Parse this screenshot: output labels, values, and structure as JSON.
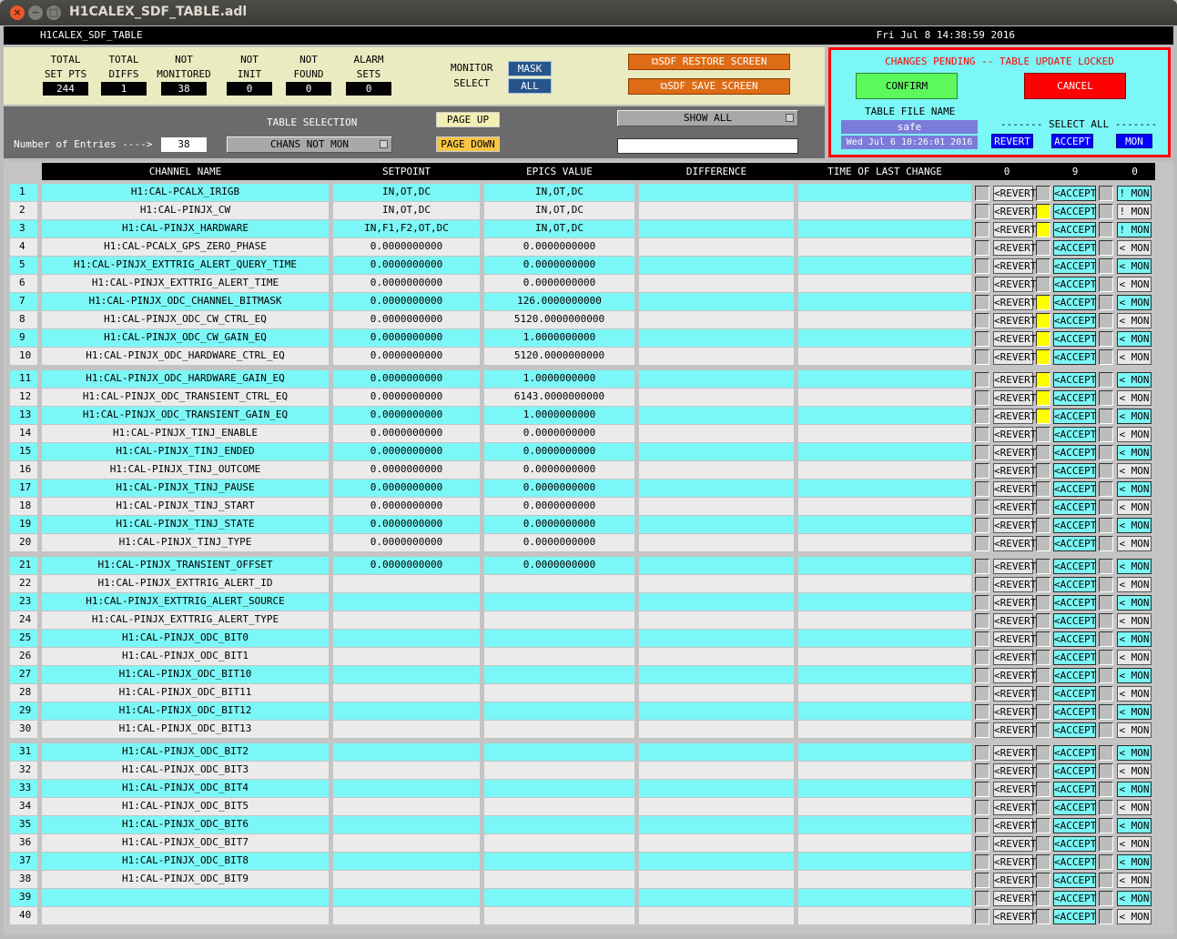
{
  "window": {
    "title": "H1CALEX_SDF_TABLE.adl"
  },
  "topbar": {
    "screen_name": "H1CALEX_SDF_TABLE",
    "datetime": "Fri Jul  8 14:38:59 2016"
  },
  "stats": [
    {
      "label": "TOTAL\nSET PTS",
      "value": "244"
    },
    {
      "label": "TOTAL\nDIFFS",
      "value": "1"
    },
    {
      "label": "NOT\nMONITORED",
      "value": "38"
    },
    {
      "label": "NOT\nINIT",
      "value": "0"
    },
    {
      "label": "NOT\nFOUND",
      "value": "0"
    },
    {
      "label": "ALARM\nSETS",
      "value": "0"
    }
  ],
  "monitor": {
    "label": "MONITOR\nSELECT",
    "mask": "MASK",
    "all": "ALL"
  },
  "buttons": {
    "restore": "SDF RESTORE SCREEN",
    "save": "SDF SAVE SCREEN"
  },
  "selection": {
    "num_entries_label": "Number of Entries ---->",
    "num_entries": "38",
    "table_selection_label": "TABLE SELECTION",
    "table_selection_value": "CHANS NOT MON",
    "page_up": "PAGE UP",
    "page_down": "PAGE DOWN",
    "show_all": "SHOW ALL",
    "filter_value": ""
  },
  "lock": {
    "message": "CHANGES PENDING -- TABLE UPDATE LOCKED",
    "confirm": "CONFIRM",
    "cancel": "CANCEL",
    "table_file_label": "TABLE FILE NAME",
    "table_file_value": "safe",
    "table_file_time": "Wed Jul  6 10:26:01 2016",
    "select_all_label": "------- SELECT ALL -------",
    "revert": "REVERT",
    "accept": "ACCEPT",
    "mon": "MON"
  },
  "table": {
    "headers": [
      "CHANNEL NAME",
      "SETPOINT",
      "EPICS VALUE",
      "DIFFERENCE",
      "TIME OF LAST CHANGE",
      "0",
      "9",
      "0"
    ],
    "revert_label": "<REVERT",
    "accept_label": "<ACCEPT",
    "rows": [
      {
        "n": "1",
        "name": "H1:CAL-PCALX_IRIGB",
        "set": "IN,OT,DC",
        "epics": "IN,OT,DC",
        "acc": false,
        "mon": "! MON"
      },
      {
        "n": "2",
        "name": "H1:CAL-PINJX_CW",
        "set": "IN,OT,DC",
        "epics": "IN,OT,DC",
        "acc": true,
        "mon": "! MON"
      },
      {
        "n": "3",
        "name": "H1:CAL-PINJX_HARDWARE",
        "set": "IN,F1,F2,OT,DC",
        "epics": "IN,OT,DC",
        "acc": true,
        "mon": "! MON"
      },
      {
        "n": "4",
        "name": "H1:CAL-PCALX_GPS_ZERO_PHASE",
        "set": "0.0000000000",
        "epics": "0.0000000000",
        "acc": false,
        "mon": "< MON"
      },
      {
        "n": "5",
        "name": "H1:CAL-PINJX_EXTTRIG_ALERT_QUERY_TIME",
        "set": "0.0000000000",
        "epics": "0.0000000000",
        "acc": false,
        "mon": "< MON"
      },
      {
        "n": "6",
        "name": "H1:CAL-PINJX_EXTTRIG_ALERT_TIME",
        "set": "0.0000000000",
        "epics": "0.0000000000",
        "acc": false,
        "mon": "< MON"
      },
      {
        "n": "7",
        "name": "H1:CAL-PINJX_ODC_CHANNEL_BITMASK",
        "set": "0.0000000000",
        "epics": "126.0000000000",
        "acc": true,
        "mon": "< MON"
      },
      {
        "n": "8",
        "name": "H1:CAL-PINJX_ODC_CW_CTRL_EQ",
        "set": "0.0000000000",
        "epics": "5120.0000000000",
        "acc": true,
        "mon": "< MON"
      },
      {
        "n": "9",
        "name": "H1:CAL-PINJX_ODC_CW_GAIN_EQ",
        "set": "0.0000000000",
        "epics": "1.0000000000",
        "acc": true,
        "mon": "< MON"
      },
      {
        "n": "10",
        "name": "H1:CAL-PINJX_ODC_HARDWARE_CTRL_EQ",
        "set": "0.0000000000",
        "epics": "5120.0000000000",
        "acc": true,
        "mon": "< MON"
      },
      {
        "n": "11",
        "name": "H1:CAL-PINJX_ODC_HARDWARE_GAIN_EQ",
        "set": "0.0000000000",
        "epics": "1.0000000000",
        "acc": true,
        "mon": "< MON"
      },
      {
        "n": "12",
        "name": "H1:CAL-PINJX_ODC_TRANSIENT_CTRL_EQ",
        "set": "0.0000000000",
        "epics": "6143.0000000000",
        "acc": true,
        "mon": "< MON"
      },
      {
        "n": "13",
        "name": "H1:CAL-PINJX_ODC_TRANSIENT_GAIN_EQ",
        "set": "0.0000000000",
        "epics": "1.0000000000",
        "acc": true,
        "mon": "< MON"
      },
      {
        "n": "14",
        "name": "H1:CAL-PINJX_TINJ_ENABLE",
        "set": "0.0000000000",
        "epics": "0.0000000000",
        "acc": false,
        "mon": "< MON"
      },
      {
        "n": "15",
        "name": "H1:CAL-PINJX_TINJ_ENDED",
        "set": "0.0000000000",
        "epics": "0.0000000000",
        "acc": false,
        "mon": "< MON"
      },
      {
        "n": "16",
        "name": "H1:CAL-PINJX_TINJ_OUTCOME",
        "set": "0.0000000000",
        "epics": "0.0000000000",
        "acc": false,
        "mon": "< MON"
      },
      {
        "n": "17",
        "name": "H1:CAL-PINJX_TINJ_PAUSE",
        "set": "0.0000000000",
        "epics": "0.0000000000",
        "acc": false,
        "mon": "< MON"
      },
      {
        "n": "18",
        "name": "H1:CAL-PINJX_TINJ_START",
        "set": "0.0000000000",
        "epics": "0.0000000000",
        "acc": false,
        "mon": "< MON"
      },
      {
        "n": "19",
        "name": "H1:CAL-PINJX_TINJ_STATE",
        "set": "0.0000000000",
        "epics": "0.0000000000",
        "acc": false,
        "mon": "< MON"
      },
      {
        "n": "20",
        "name": "H1:CAL-PINJX_TINJ_TYPE",
        "set": "0.0000000000",
        "epics": "0.0000000000",
        "acc": false,
        "mon": "< MON"
      },
      {
        "n": "21",
        "name": "H1:CAL-PINJX_TRANSIENT_OFFSET",
        "set": "0.0000000000",
        "epics": "0.0000000000",
        "acc": false,
        "mon": "< MON"
      },
      {
        "n": "22",
        "name": "H1:CAL-PINJX_EXTTRIG_ALERT_ID",
        "set": "",
        "epics": "",
        "acc": false,
        "mon": "< MON"
      },
      {
        "n": "23",
        "name": "H1:CAL-PINJX_EXTTRIG_ALERT_SOURCE",
        "set": "",
        "epics": "",
        "acc": false,
        "mon": "< MON"
      },
      {
        "n": "24",
        "name": "H1:CAL-PINJX_EXTTRIG_ALERT_TYPE",
        "set": "",
        "epics": "",
        "acc": false,
        "mon": "< MON"
      },
      {
        "n": "25",
        "name": "H1:CAL-PINJX_ODC_BIT0",
        "set": "",
        "epics": "",
        "acc": false,
        "mon": "< MON"
      },
      {
        "n": "26",
        "name": "H1:CAL-PINJX_ODC_BIT1",
        "set": "",
        "epics": "",
        "acc": false,
        "mon": "< MON"
      },
      {
        "n": "27",
        "name": "H1:CAL-PINJX_ODC_BIT10",
        "set": "",
        "epics": "",
        "acc": false,
        "mon": "< MON"
      },
      {
        "n": "28",
        "name": "H1:CAL-PINJX_ODC_BIT11",
        "set": "",
        "epics": "",
        "acc": false,
        "mon": "< MON"
      },
      {
        "n": "29",
        "name": "H1:CAL-PINJX_ODC_BIT12",
        "set": "",
        "epics": "",
        "acc": false,
        "mon": "< MON"
      },
      {
        "n": "30",
        "name": "H1:CAL-PINJX_ODC_BIT13",
        "set": "",
        "epics": "",
        "acc": false,
        "mon": "< MON"
      },
      {
        "n": "31",
        "name": "H1:CAL-PINJX_ODC_BIT2",
        "set": "",
        "epics": "",
        "acc": false,
        "mon": "< MON"
      },
      {
        "n": "32",
        "name": "H1:CAL-PINJX_ODC_BIT3",
        "set": "",
        "epics": "",
        "acc": false,
        "mon": "< MON"
      },
      {
        "n": "33",
        "name": "H1:CAL-PINJX_ODC_BIT4",
        "set": "",
        "epics": "",
        "acc": false,
        "mon": "< MON"
      },
      {
        "n": "34",
        "name": "H1:CAL-PINJX_ODC_BIT5",
        "set": "",
        "epics": "",
        "acc": false,
        "mon": "< MON"
      },
      {
        "n": "35",
        "name": "H1:CAL-PINJX_ODC_BIT6",
        "set": "",
        "epics": "",
        "acc": false,
        "mon": "< MON"
      },
      {
        "n": "36",
        "name": "H1:CAL-PINJX_ODC_BIT7",
        "set": "",
        "epics": "",
        "acc": false,
        "mon": "< MON"
      },
      {
        "n": "37",
        "name": "H1:CAL-PINJX_ODC_BIT8",
        "set": "",
        "epics": "",
        "acc": false,
        "mon": "< MON"
      },
      {
        "n": "38",
        "name": "H1:CAL-PINJX_ODC_BIT9",
        "set": "",
        "epics": "",
        "acc": false,
        "mon": "< MON"
      },
      {
        "n": "39",
        "name": "",
        "set": "",
        "epics": "",
        "acc": false,
        "mon": "< MON"
      },
      {
        "n": "40",
        "name": "",
        "set": "",
        "epics": "",
        "acc": false,
        "mon": "< MON"
      }
    ]
  }
}
